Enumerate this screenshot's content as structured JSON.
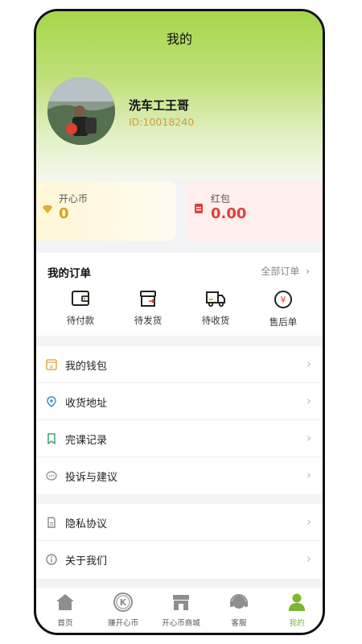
{
  "header": {
    "title": "我的"
  },
  "user": {
    "name": "洗车工王哥",
    "id_text": "ID:10018240"
  },
  "wallet_cards": {
    "coin": {
      "label": "开心币",
      "value": "0",
      "icon": "diamond-icon",
      "color": "#d9a21a"
    },
    "redpacket": {
      "label": "红包",
      "value": "0.00",
      "icon": "red-envelope-icon",
      "color": "#e0403a"
    }
  },
  "orders": {
    "title": "我的订单",
    "all_label": "全部订单",
    "items": [
      {
        "label": "待付款",
        "icon": "wallet-card-icon"
      },
      {
        "label": "待发货",
        "icon": "box-icon"
      },
      {
        "label": "待收货",
        "icon": "truck-icon"
      },
      {
        "label": "售后单",
        "icon": "refund-icon"
      }
    ]
  },
  "menu1": [
    {
      "label": "我的钱包",
      "icon": "wallet-icon",
      "color": "#e0a94a"
    },
    {
      "label": "收货地址",
      "icon": "location-pin-icon",
      "color": "#3b8fd9"
    },
    {
      "label": "完课记录",
      "icon": "bookmark-icon",
      "color": "#3aa86a"
    },
    {
      "label": "投诉与建议",
      "icon": "chat-bubble-icon",
      "color": "#999999"
    }
  ],
  "menu2": [
    {
      "label": "隐私协议",
      "icon": "document-icon",
      "color": "#888888"
    },
    {
      "label": "关于我们",
      "icon": "info-icon",
      "color": "#888888"
    }
  ],
  "tabbar": [
    {
      "label": "首页",
      "icon": "home-icon",
      "active": false
    },
    {
      "label": "赚开心币",
      "icon": "k-coin-icon",
      "active": false
    },
    {
      "label": "开心币商城",
      "icon": "store-icon",
      "active": false
    },
    {
      "label": "客服",
      "icon": "headset-icon",
      "active": false
    },
    {
      "label": "我的",
      "icon": "person-icon",
      "active": true
    }
  ],
  "colors": {
    "accent": "#7ab82e",
    "header_green": "#a6d64a"
  }
}
